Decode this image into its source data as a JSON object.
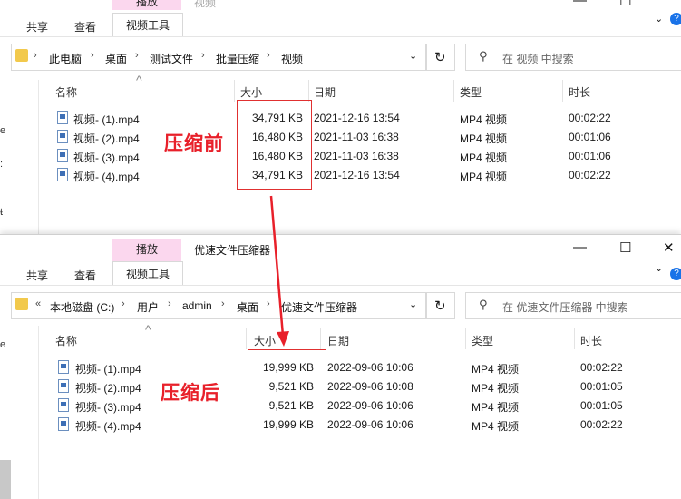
{
  "window1": {
    "context_tab": "播放",
    "title": "视频",
    "ribbon": {
      "share": "共享",
      "view": "查看",
      "tools": "视频工具"
    },
    "breadcrumb": [
      "此电脑",
      "桌面",
      "测试文件",
      "批量压缩",
      "视频"
    ],
    "search_placeholder": "在 视频 中搜索",
    "columns": {
      "name": "名称",
      "size": "大小",
      "date": "日期",
      "type": "类型",
      "duration": "时长"
    },
    "files": [
      {
        "name": "视频- (1).mp4",
        "size": "34,791 KB",
        "date": "2021-12-16 13:54",
        "type": "MP4 视频",
        "duration": "00:02:22"
      },
      {
        "name": "视频- (2).mp4",
        "size": "16,480 KB",
        "date": "2021-11-03 16:38",
        "type": "MP4 视频",
        "duration": "00:01:06"
      },
      {
        "name": "视频- (3).mp4",
        "size": "16,480 KB",
        "date": "2021-11-03 16:38",
        "type": "MP4 视频",
        "duration": "00:01:06"
      },
      {
        "name": "视频- (4).mp4",
        "size": "34,791 KB",
        "date": "2021-12-16 13:54",
        "type": "MP4 视频",
        "duration": "00:02:22"
      }
    ],
    "annotation": "压缩前"
  },
  "window2": {
    "context_tab": "播放",
    "title": "优速文件压缩器",
    "ribbon": {
      "share": "共享",
      "view": "查看",
      "tools": "视频工具"
    },
    "breadcrumb_prefix": "«",
    "breadcrumb": [
      "本地磁盘 (C:)",
      "用户",
      "admin",
      "桌面",
      "优速文件压缩器"
    ],
    "search_placeholder": "在 优速文件压缩器 中搜索",
    "columns": {
      "name": "名称",
      "size": "大小",
      "date": "日期",
      "type": "类型",
      "duration": "时长"
    },
    "files": [
      {
        "name": "视频- (1).mp4",
        "size": "19,999 KB",
        "date": "2022-09-06 10:06",
        "type": "MP4 视频",
        "duration": "00:02:22"
      },
      {
        "name": "视频- (2).mp4",
        "size": "9,521 KB",
        "date": "2022-09-06 10:08",
        "type": "MP4 视频",
        "duration": "00:01:05"
      },
      {
        "name": "视频- (3).mp4",
        "size": "9,521 KB",
        "date": "2022-09-06 10:06",
        "type": "MP4 视频",
        "duration": "00:01:05"
      },
      {
        "name": "视频- (4).mp4",
        "size": "19,999 KB",
        "date": "2022-09-06 10:06",
        "type": "MP4 视频",
        "duration": "00:02:22"
      }
    ],
    "annotation": "压缩后"
  },
  "colors": {
    "accent_red": "#e8202a",
    "context_tab_bg": "#fbd7ee",
    "folder": "#f2c94c",
    "help": "#1a73e8"
  }
}
